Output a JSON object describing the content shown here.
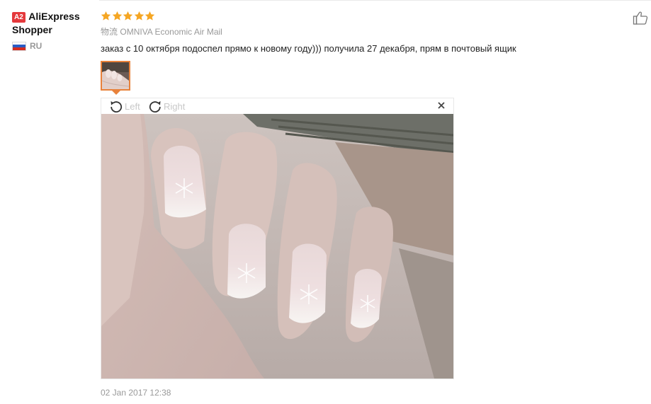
{
  "user": {
    "level_badge": "A2",
    "name": "AliExpress Shopper",
    "country_code": "RU",
    "flag_colors": [
      "#ffffff",
      "#2a5cc4",
      "#d52b1e"
    ]
  },
  "review": {
    "rating": 5,
    "star_color": "#f5a623",
    "logistics_label": "物流",
    "logistics_value": "OMNIVA Economic Air Mail",
    "text": "заказ с 10 октября подоспел прямо к новому году))) получила 27 декабря, прям в почтовый ящик",
    "date": "02 Jan 2017 12:38"
  },
  "viewer": {
    "rotate_left_label": "Left",
    "rotate_right_label": "Right",
    "close_icon": "close-icon"
  },
  "actions": {
    "helpful_icon": "thumbs-up-icon"
  },
  "colors": {
    "accent": "#e8823b",
    "badge": "#e4393c",
    "muted": "#999999"
  }
}
